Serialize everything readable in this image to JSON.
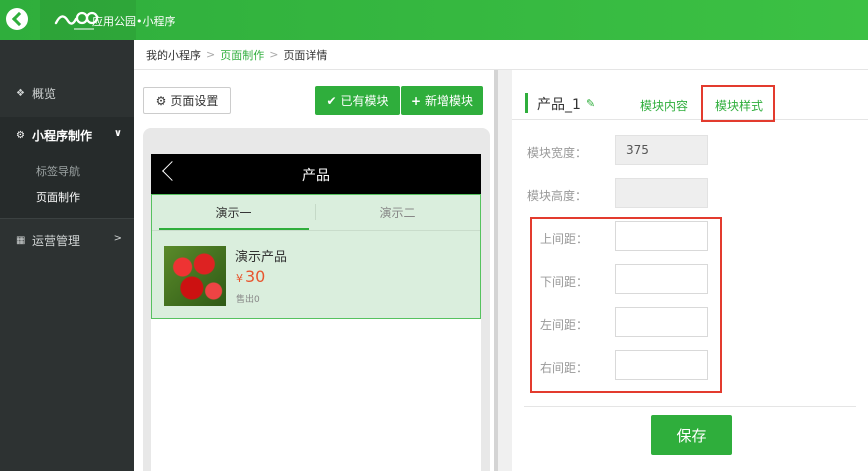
{
  "topbar": {
    "app_title": "应用公园•小程序"
  },
  "sidebar": {
    "items": [
      {
        "label": "概览"
      },
      {
        "label": "小程序制作"
      },
      {
        "label": "运营管理"
      }
    ],
    "subitems": [
      {
        "label": "标签导航"
      },
      {
        "label": "页面制作"
      }
    ]
  },
  "breadcrumb": [
    "我的小程序",
    "页面制作",
    "页面详情"
  ],
  "toolbar": {
    "page_settings": "页面设置",
    "existing_modules": "已有模块",
    "new_module": "新增模块"
  },
  "phone": {
    "title": "产品",
    "tabs": [
      "演示一",
      "演示二"
    ],
    "product": {
      "name": "演示产品",
      "currency": "¥",
      "price": "30",
      "sold": "售出0"
    }
  },
  "panel": {
    "title": "产品_1",
    "tabs": {
      "content": "模块内容",
      "style": "模块样式"
    },
    "fields": {
      "width_label": "模块宽度：",
      "width_value": "375",
      "height_label": "模块高度：",
      "height_value": "",
      "margin_top_label": "上间距：",
      "margin_bottom_label": "下间距：",
      "margin_left_label": "左间距：",
      "margin_right_label": "右间距："
    },
    "save": "保存"
  },
  "colors": {
    "brand_green": "#2fae3c",
    "highlight_red": "#e33b2e",
    "price_orange": "#e8562f"
  }
}
